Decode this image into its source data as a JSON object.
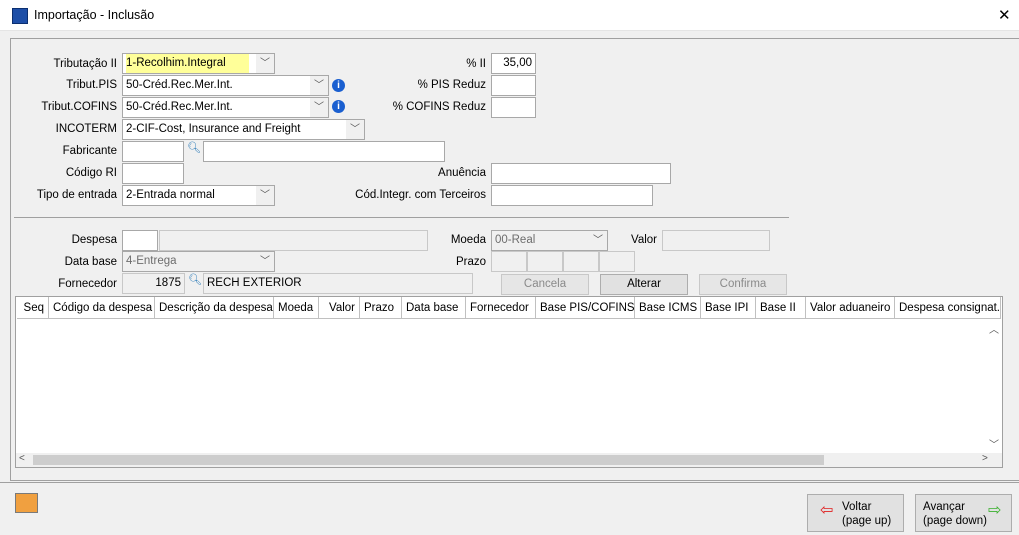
{
  "window": {
    "title": "Importação - Inclusão",
    "close": "✕"
  },
  "form": {
    "tributacao_ii": {
      "label": "Tributação II",
      "value": "1-Recolhim.Integral"
    },
    "tribut_pis": {
      "label": "Tribut.PIS",
      "value": "50-Créd.Rec.Mer.Int."
    },
    "tribut_cofins": {
      "label": "Tribut.COFINS",
      "value": "50-Créd.Rec.Mer.Int."
    },
    "incoterm": {
      "label": "INCOTERM",
      "value": "2-CIF-Cost, Insurance and Freight"
    },
    "fabricante": {
      "label": "Fabricante",
      "code": "",
      "name": ""
    },
    "codigo_ri": {
      "label": "Código RI",
      "value": ""
    },
    "tipo_entrada": {
      "label": "Tipo de entrada",
      "value": "2-Entrada normal"
    },
    "pct_ii": {
      "label": "% II",
      "value": "35,00"
    },
    "pct_pis_reduz": {
      "label": "% PIS Reduz",
      "value": ""
    },
    "pct_cofins_reduz": {
      "label": "% COFINS Reduz",
      "value": ""
    },
    "anuencia": {
      "label": "Anuência",
      "value": ""
    },
    "cod_integr": {
      "label": "Cód.Integr. com Terceiros",
      "value": ""
    }
  },
  "despesa": {
    "despesa": {
      "label": "Despesa",
      "code": "",
      "desc": ""
    },
    "data_base": {
      "label": "Data base",
      "value": "4-Entrega"
    },
    "fornecedor": {
      "label": "Fornecedor",
      "code": "1875",
      "name": "RECH EXTERIOR"
    },
    "moeda": {
      "label": "Moeda",
      "value": "00-Real"
    },
    "valor": {
      "label": "Valor",
      "value": ""
    },
    "prazo": {
      "label": "Prazo"
    },
    "cancela": "Cancela",
    "alterar": "Alterar",
    "confirma": "Confirma"
  },
  "grid": {
    "columns": [
      "Seq",
      "Código da despesa",
      "Descrição da despesa",
      "Moeda",
      "Valor",
      "Prazo",
      "Data base",
      "Fornecedor",
      "Base PIS/COFINS",
      "Base ICMS",
      "Base IPI",
      "Base II",
      "Valor aduaneiro",
      "Despesa consignat."
    ],
    "rows": []
  },
  "footer": {
    "voltar": "Voltar",
    "voltar_sub": "(page up)",
    "avancar": "Avançar",
    "avancar_sub": "(page down)"
  },
  "colors": {
    "highlight": "#ffff99",
    "info": "#1a5fd0"
  }
}
